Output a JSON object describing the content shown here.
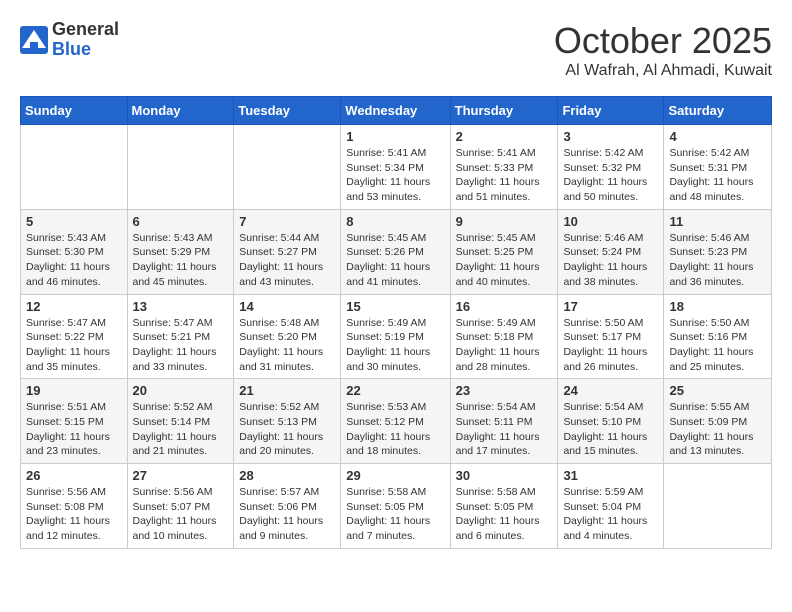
{
  "logo": {
    "general": "General",
    "blue": "Blue"
  },
  "title": "October 2025",
  "location": "Al Wafrah, Al Ahmadi, Kuwait",
  "days_header": [
    "Sunday",
    "Monday",
    "Tuesday",
    "Wednesday",
    "Thursday",
    "Friday",
    "Saturday"
  ],
  "weeks": [
    [
      {
        "day": "",
        "info": ""
      },
      {
        "day": "",
        "info": ""
      },
      {
        "day": "",
        "info": ""
      },
      {
        "day": "1",
        "info": "Sunrise: 5:41 AM\nSunset: 5:34 PM\nDaylight: 11 hours\nand 53 minutes."
      },
      {
        "day": "2",
        "info": "Sunrise: 5:41 AM\nSunset: 5:33 PM\nDaylight: 11 hours\nand 51 minutes."
      },
      {
        "day": "3",
        "info": "Sunrise: 5:42 AM\nSunset: 5:32 PM\nDaylight: 11 hours\nand 50 minutes."
      },
      {
        "day": "4",
        "info": "Sunrise: 5:42 AM\nSunset: 5:31 PM\nDaylight: 11 hours\nand 48 minutes."
      }
    ],
    [
      {
        "day": "5",
        "info": "Sunrise: 5:43 AM\nSunset: 5:30 PM\nDaylight: 11 hours\nand 46 minutes."
      },
      {
        "day": "6",
        "info": "Sunrise: 5:43 AM\nSunset: 5:29 PM\nDaylight: 11 hours\nand 45 minutes."
      },
      {
        "day": "7",
        "info": "Sunrise: 5:44 AM\nSunset: 5:27 PM\nDaylight: 11 hours\nand 43 minutes."
      },
      {
        "day": "8",
        "info": "Sunrise: 5:45 AM\nSunset: 5:26 PM\nDaylight: 11 hours\nand 41 minutes."
      },
      {
        "day": "9",
        "info": "Sunrise: 5:45 AM\nSunset: 5:25 PM\nDaylight: 11 hours\nand 40 minutes."
      },
      {
        "day": "10",
        "info": "Sunrise: 5:46 AM\nSunset: 5:24 PM\nDaylight: 11 hours\nand 38 minutes."
      },
      {
        "day": "11",
        "info": "Sunrise: 5:46 AM\nSunset: 5:23 PM\nDaylight: 11 hours\nand 36 minutes."
      }
    ],
    [
      {
        "day": "12",
        "info": "Sunrise: 5:47 AM\nSunset: 5:22 PM\nDaylight: 11 hours\nand 35 minutes."
      },
      {
        "day": "13",
        "info": "Sunrise: 5:47 AM\nSunset: 5:21 PM\nDaylight: 11 hours\nand 33 minutes."
      },
      {
        "day": "14",
        "info": "Sunrise: 5:48 AM\nSunset: 5:20 PM\nDaylight: 11 hours\nand 31 minutes."
      },
      {
        "day": "15",
        "info": "Sunrise: 5:49 AM\nSunset: 5:19 PM\nDaylight: 11 hours\nand 30 minutes."
      },
      {
        "day": "16",
        "info": "Sunrise: 5:49 AM\nSunset: 5:18 PM\nDaylight: 11 hours\nand 28 minutes."
      },
      {
        "day": "17",
        "info": "Sunrise: 5:50 AM\nSunset: 5:17 PM\nDaylight: 11 hours\nand 26 minutes."
      },
      {
        "day": "18",
        "info": "Sunrise: 5:50 AM\nSunset: 5:16 PM\nDaylight: 11 hours\nand 25 minutes."
      }
    ],
    [
      {
        "day": "19",
        "info": "Sunrise: 5:51 AM\nSunset: 5:15 PM\nDaylight: 11 hours\nand 23 minutes."
      },
      {
        "day": "20",
        "info": "Sunrise: 5:52 AM\nSunset: 5:14 PM\nDaylight: 11 hours\nand 21 minutes."
      },
      {
        "day": "21",
        "info": "Sunrise: 5:52 AM\nSunset: 5:13 PM\nDaylight: 11 hours\nand 20 minutes."
      },
      {
        "day": "22",
        "info": "Sunrise: 5:53 AM\nSunset: 5:12 PM\nDaylight: 11 hours\nand 18 minutes."
      },
      {
        "day": "23",
        "info": "Sunrise: 5:54 AM\nSunset: 5:11 PM\nDaylight: 11 hours\nand 17 minutes."
      },
      {
        "day": "24",
        "info": "Sunrise: 5:54 AM\nSunset: 5:10 PM\nDaylight: 11 hours\nand 15 minutes."
      },
      {
        "day": "25",
        "info": "Sunrise: 5:55 AM\nSunset: 5:09 PM\nDaylight: 11 hours\nand 13 minutes."
      }
    ],
    [
      {
        "day": "26",
        "info": "Sunrise: 5:56 AM\nSunset: 5:08 PM\nDaylight: 11 hours\nand 12 minutes."
      },
      {
        "day": "27",
        "info": "Sunrise: 5:56 AM\nSunset: 5:07 PM\nDaylight: 11 hours\nand 10 minutes."
      },
      {
        "day": "28",
        "info": "Sunrise: 5:57 AM\nSunset: 5:06 PM\nDaylight: 11 hours\nand 9 minutes."
      },
      {
        "day": "29",
        "info": "Sunrise: 5:58 AM\nSunset: 5:05 PM\nDaylight: 11 hours\nand 7 minutes."
      },
      {
        "day": "30",
        "info": "Sunrise: 5:58 AM\nSunset: 5:05 PM\nDaylight: 11 hours\nand 6 minutes."
      },
      {
        "day": "31",
        "info": "Sunrise: 5:59 AM\nSunset: 5:04 PM\nDaylight: 11 hours\nand 4 minutes."
      },
      {
        "day": "",
        "info": ""
      }
    ]
  ]
}
